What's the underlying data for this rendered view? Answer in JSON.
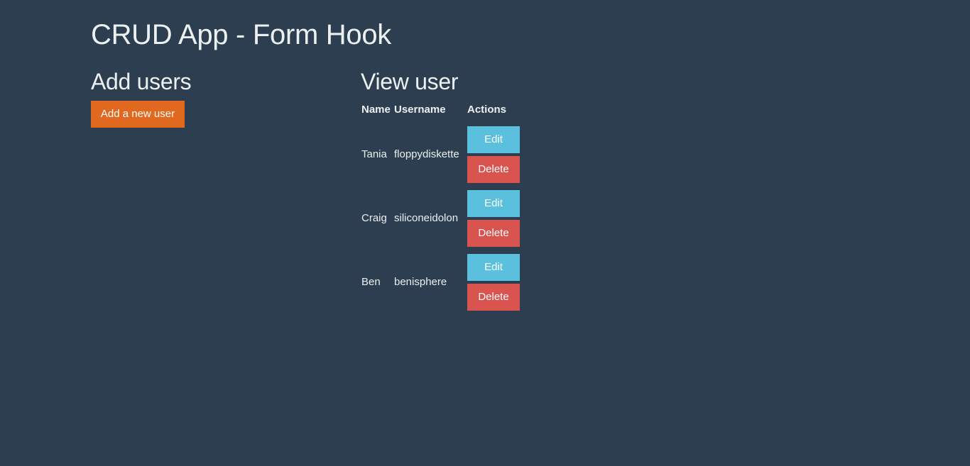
{
  "app": {
    "title": "CRUD App - Form Hook"
  },
  "add_section": {
    "title": "Add users",
    "add_button_label": "Add a new user"
  },
  "view_section": {
    "title": "View user",
    "columns": [
      "Name",
      "Username",
      "Actions"
    ],
    "rows": [
      {
        "name": "Tania",
        "username": "floppydiskette",
        "edit_label": "Edit",
        "delete_label": "Delete"
      },
      {
        "name": "Craig",
        "username": "siliconeidolon",
        "edit_label": "Edit",
        "delete_label": "Delete"
      },
      {
        "name": "Ben",
        "username": "benisphere",
        "edit_label": "Edit",
        "delete_label": "Delete"
      }
    ]
  },
  "colors": {
    "background": "#2c3e50",
    "text": "#ecf0f1",
    "add_button": "#e0681f",
    "edit_button": "#5bc0de",
    "delete_button": "#d9534f"
  }
}
